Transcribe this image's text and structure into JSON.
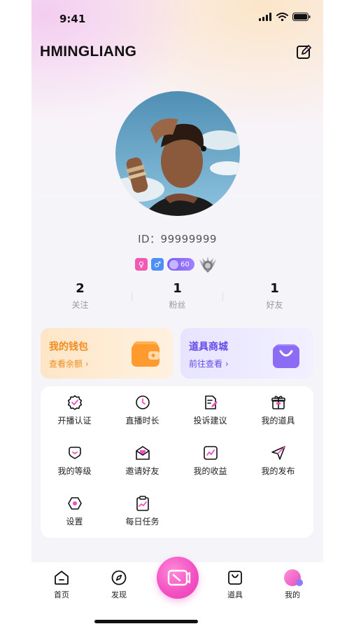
{
  "status_bar": {
    "time": "9:41"
  },
  "header": {
    "title": "HMINGLIANG"
  },
  "profile": {
    "id_label": "ID：99999999",
    "level_badge": "60",
    "stats": [
      {
        "value": "2",
        "label": "关注"
      },
      {
        "value": "1",
        "label": "粉丝"
      },
      {
        "value": "1",
        "label": "好友"
      }
    ]
  },
  "cards": {
    "wallet": {
      "title": "我的钱包",
      "sub": "查看余额 ›"
    },
    "shop": {
      "title": "道具商城",
      "sub": "前往查看 ›"
    }
  },
  "menu": [
    {
      "label": "开播认证",
      "icon": "badge-check-icon"
    },
    {
      "label": "直播时长",
      "icon": "clock-icon"
    },
    {
      "label": "投诉建议",
      "icon": "feedback-icon"
    },
    {
      "label": "我的道具",
      "icon": "gift-icon"
    },
    {
      "label": "我的等级",
      "icon": "level-icon"
    },
    {
      "label": "邀请好友",
      "icon": "invite-icon"
    },
    {
      "label": "我的收益",
      "icon": "earnings-icon"
    },
    {
      "label": "我的发布",
      "icon": "send-icon"
    },
    {
      "label": "设置",
      "icon": "settings-icon"
    },
    {
      "label": "每日任务",
      "icon": "task-icon"
    }
  ],
  "tabbar": [
    {
      "label": "首页",
      "icon": "home-icon"
    },
    {
      "label": "发现",
      "icon": "compass-icon"
    },
    {
      "label": "道具",
      "icon": "bag-icon"
    },
    {
      "label": "我的",
      "icon": "profile-icon"
    }
  ],
  "colors": {
    "accent_pink": "#f24fc2",
    "wallet_orange": "#f08c1e",
    "shop_purple": "#6448e6"
  }
}
